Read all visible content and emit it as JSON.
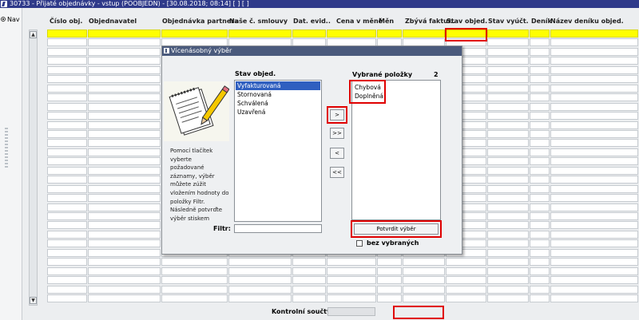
{
  "window": {
    "title": "30733 - Přijaté objednávky - vstup (POOBJEDN) - [30.08.2018; 08:14] [ ] [ ]"
  },
  "nav": {
    "label": "Nav"
  },
  "table": {
    "columns": [
      "Číslo obj.",
      "Objednavatel",
      "Objednávka partnera",
      "Naše č. smlouvy",
      "Dat. evid..",
      "Cena v měně",
      "Měn",
      "Zbývá faktur..",
      "Stav objed.",
      "Stav vyúčt.",
      "Deník",
      "Název deníku objed."
    ],
    "selected_row": 0
  },
  "footer": {
    "label": "Kontrolní součty"
  },
  "dialog": {
    "title": "Vícenásobný výběr",
    "available_label": "Stav objed.",
    "available_items": [
      "Vyfakturovaná",
      "Stornovaná",
      "Schválená",
      "Uzavřená"
    ],
    "available_selected_index": 0,
    "selected_label": "Vybrané položky",
    "selected_count": "2",
    "selected_items": [
      "Chybová",
      "Doplněná"
    ],
    "buttons": {
      "move_one": ">",
      "move_all": ">>",
      "remove_one": "<",
      "remove_all": "<<",
      "confirm": "Potvrdit výběr"
    },
    "filter_label": "Filtr:",
    "filter_value": "",
    "checkbox_label": "bez vybraných",
    "checkbox_checked": false,
    "help_lines": [
      "Pomocí tlačítek",
      "vyberte",
      "požadované",
      "záznamy, výběr",
      "můžete zúžit",
      "vložením hodnoty do",
      "položky Filtr.",
      "Následně potvrďte",
      "výběr stiskem"
    ]
  },
  "colors": {
    "title_bar": "#2f3a8a",
    "selected_row": "#ffff00",
    "highlight": "#e00000",
    "list_selection": "#2f5fc0"
  }
}
